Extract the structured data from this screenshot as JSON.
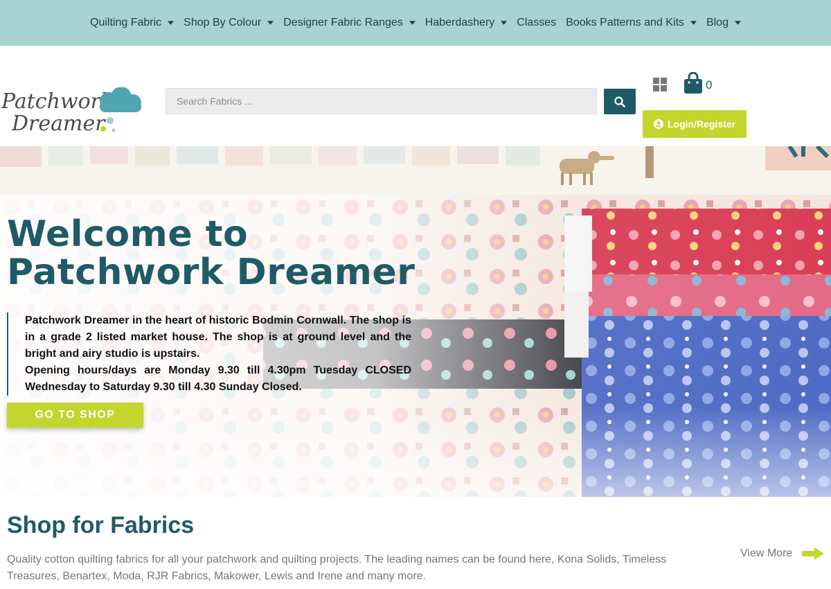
{
  "nav": {
    "items": [
      {
        "label": "Quilting Fabric",
        "dropdown": true
      },
      {
        "label": "Shop By Colour",
        "dropdown": true
      },
      {
        "label": "Designer Fabric Ranges",
        "dropdown": true
      },
      {
        "label": "Haberdashery",
        "dropdown": true
      },
      {
        "label": "Classes",
        "dropdown": false
      },
      {
        "label": "Books Patterns and Kits",
        "dropdown": true
      },
      {
        "label": "Blog",
        "dropdown": true
      }
    ]
  },
  "header": {
    "logo_text_line1": "Patchwork",
    "logo_text_line2": "Dreamer",
    "search_placeholder": "Search Fabrics ...",
    "cart_count": "0",
    "login_label": "Login/Register"
  },
  "hero": {
    "title_line1": "Welcome to",
    "title_line2": "Patchwork Dreamer",
    "paragraph1": "Patchwork Dreamer in the heart of historic Bodmin Cornwall. The shop is in a grade 2 listed market house. The shop is at ground level and the bright and airy studio is upstairs.",
    "paragraph2": "Opening hours/days are Monday 9.30 till 4.30pm Tuesday CLOSED Wednesday to Saturday 9.30 till 4.30 Sunday Closed.",
    "button_label": "GO TO SHOP"
  },
  "shop": {
    "title": "Shop for Fabrics",
    "description": "Quality cotton quilting fabrics for all your patchwork and quilting projects. The leading names can be found here, Kona Solids, Timeless Treasures, Benartex, Moda, RJR Fabrics, Makower, Lewis and Irene and many more.",
    "view_more_label": "View More"
  },
  "colors": {
    "nav_bg": "#a9d3d2",
    "teal": "#1f5b66",
    "lime": "#c2d62d"
  }
}
